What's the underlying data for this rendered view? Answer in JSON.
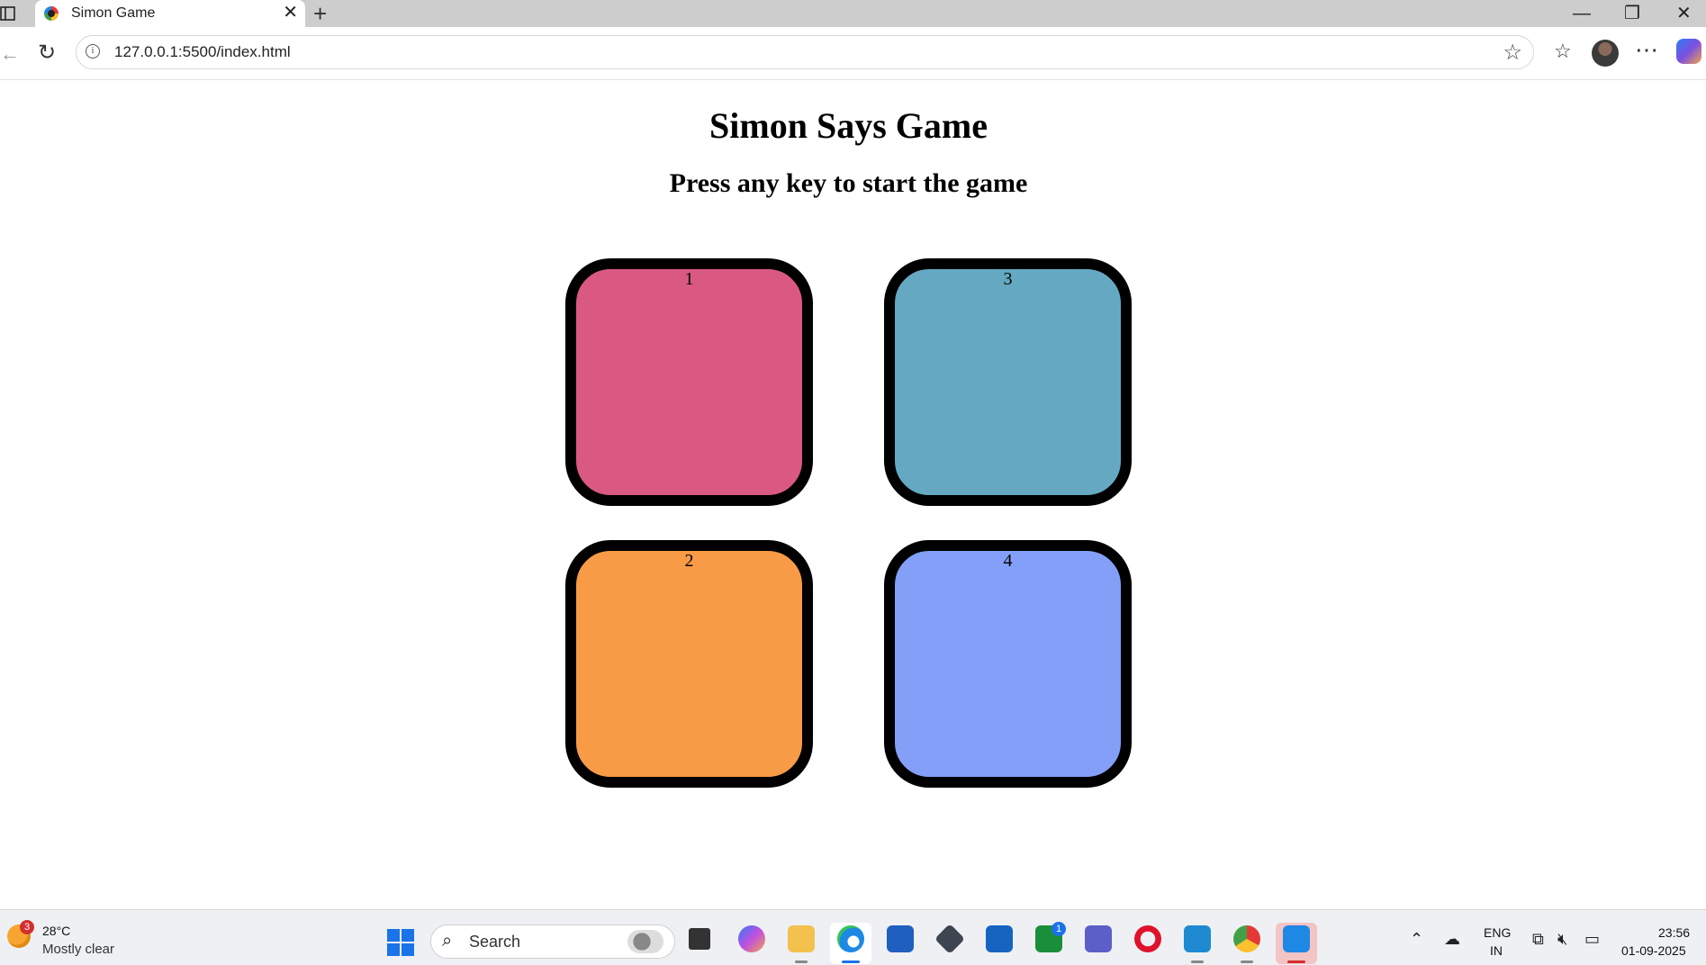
{
  "browser": {
    "tab_title": "Simon Game",
    "tab_close": "✕",
    "new_tab": "+",
    "address": "127.0.0.1:5500/index.html",
    "window_controls": {
      "minimize": "—",
      "restore": "❐",
      "close": "✕"
    }
  },
  "page": {
    "title": "Simon Says Game",
    "status": "Press any key to start the game",
    "buttons": [
      {
        "label": "1",
        "color": "#da5980"
      },
      {
        "label": "3",
        "color": "#64a9c1"
      },
      {
        "label": "2",
        "color": "#f89b46"
      },
      {
        "label": "4",
        "color": "#839ff7"
      }
    ]
  },
  "taskbar": {
    "weather": {
      "badge": "3",
      "temp": "28°C",
      "desc": "Mostly clear"
    },
    "search_label": "Search",
    "edge_badge": "1",
    "tray": {
      "lang_top": "ENG",
      "lang_bottom": "IN",
      "time": "23:56",
      "date": "01-09-2025"
    }
  }
}
